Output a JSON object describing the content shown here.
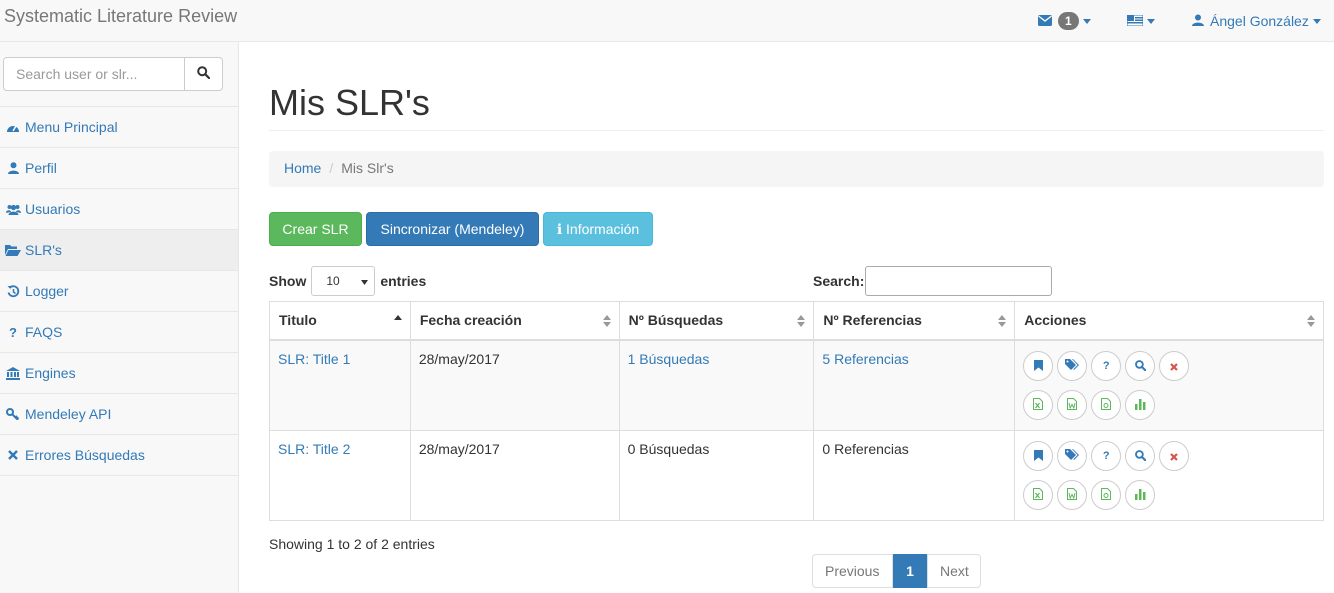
{
  "app": {
    "title": "Systematic Literature Review"
  },
  "navbar": {
    "message_count": "1",
    "user_name": "Ángel González"
  },
  "sidebar": {
    "search_placeholder": "Search user or slr...",
    "items": [
      {
        "label": "Menu Principal",
        "icon": "dashboard-icon"
      },
      {
        "label": "Perfil",
        "icon": "user-icon"
      },
      {
        "label": "Usuarios",
        "icon": "users-icon"
      },
      {
        "label": "SLR's",
        "icon": "folder-open-icon"
      },
      {
        "label": "Logger",
        "icon": "history-icon"
      },
      {
        "label": "FAQS",
        "icon": "question-icon"
      },
      {
        "label": "Engines",
        "icon": "bank-icon"
      },
      {
        "label": "Mendeley API",
        "icon": "key-icon"
      },
      {
        "label": "Errores Búsquedas",
        "icon": "times-icon"
      }
    ]
  },
  "page": {
    "title": "Mis SLR's",
    "breadcrumb": {
      "home": "Home",
      "current": "Mis Slr's"
    },
    "buttons": {
      "create": "Crear SLR",
      "sync": "Sincronizar (Mendeley)",
      "info": "ℹ Información"
    }
  },
  "table": {
    "show_label": "Show",
    "length_value": "10",
    "entries_label": "entries",
    "search_label": "Search:",
    "headers": [
      "Titulo",
      "Fecha creación",
      "Nº Búsquedas",
      "Nº Referencias",
      "Acciones"
    ],
    "rows": [
      {
        "title": "SLR: Title 1",
        "date": "28/may/2017",
        "searches": "1 Búsquedas",
        "references": "5 Referencias"
      },
      {
        "title": "SLR: Title 2",
        "date": "28/may/2017",
        "searches": "0 Búsquedas",
        "references": "0 Referencias"
      }
    ],
    "info": "Showing 1 to 2 of 2 entries",
    "pagination": {
      "previous": "Previous",
      "current": "1",
      "next": "Next"
    }
  },
  "colors": {
    "primary": "#337ab7",
    "success": "#5cb85c",
    "info": "#5bc0de",
    "danger": "#d9534f"
  }
}
